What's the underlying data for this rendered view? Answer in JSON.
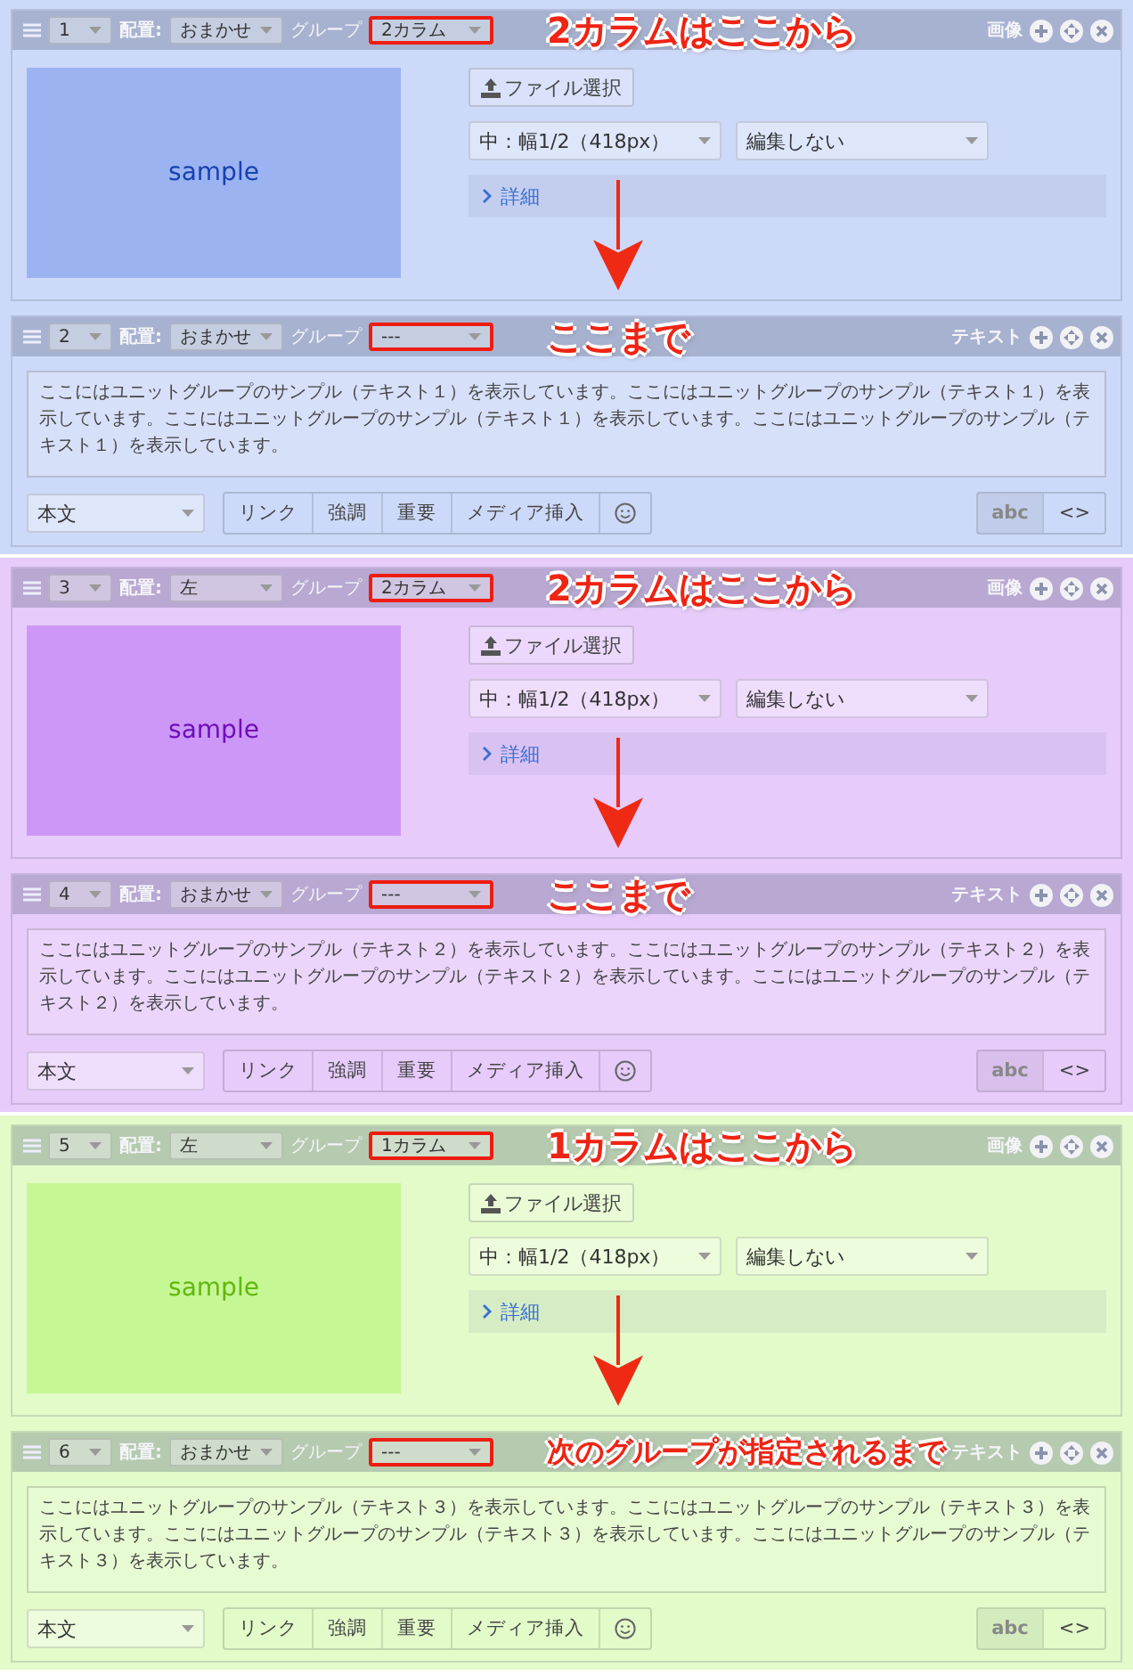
{
  "groups": [
    {
      "color": "#cdd9f8",
      "units": [
        {
          "kind": "image",
          "number": "1",
          "placement_label": "配置:",
          "placement": "おまかせ",
          "group_label": "グループ",
          "group_value": "2カラム",
          "group_highlighted": true,
          "type_label": "画像",
          "picture_label": "sample",
          "file_button": "ファイル選択",
          "size_select": "中：幅1/2（418px）",
          "edit_select": "編集しない",
          "details": "詳細",
          "callout": [
            "2カラムはここから"
          ],
          "arrow": true
        },
        {
          "kind": "text",
          "number": "2",
          "placement_label": "配置:",
          "placement": "おまかせ",
          "group_label": "グループ",
          "group_value": "---",
          "group_highlighted": true,
          "type_label": "テキスト",
          "text": "ここにはユニットグループのサンプル（テキスト１）を表示しています。ここにはユニットグループのサンプル（テキスト１）を表示しています。ここにはユニットグループのサンプル（テキスト１）を表示しています。ここにはユニットグループのサンプル（テキスト１）を表示しています。",
          "style_select": "本文",
          "buttons": [
            "リンク",
            "強調",
            "重要",
            "メディア挿入"
          ],
          "abc_button": "abc",
          "abc_disabled": true,
          "code_button": "<>",
          "callout": [
            "ここまで"
          ]
        }
      ]
    },
    {
      "color": "#e6cbfb",
      "units": [
        {
          "kind": "image",
          "number": "3",
          "placement_label": "配置:",
          "placement": "左",
          "group_label": "グループ",
          "group_value": "2カラム",
          "group_highlighted": true,
          "type_label": "画像",
          "picture_label": "sample",
          "file_button": "ファイル選択",
          "size_select": "中：幅1/2（418px）",
          "edit_select": "編集しない",
          "details": "詳細",
          "callout": [
            "2カラムはここから"
          ],
          "arrow": true
        },
        {
          "kind": "text",
          "number": "4",
          "placement_label": "配置:",
          "placement": "おまかせ",
          "group_label": "グループ",
          "group_value": "---",
          "group_highlighted": true,
          "type_label": "テキスト",
          "text": "ここにはユニットグループのサンプル（テキスト２）を表示しています。ここにはユニットグループのサンプル（テキスト２）を表示しています。ここにはユニットグループのサンプル（テキスト２）を表示しています。ここにはユニットグループのサンプル（テキスト２）を表示しています。",
          "style_select": "本文",
          "buttons": [
            "リンク",
            "強調",
            "重要",
            "メディア挿入"
          ],
          "abc_button": "abc",
          "abc_disabled": true,
          "code_button": "<>",
          "callout": [
            "ここまで"
          ]
        }
      ]
    },
    {
      "color": "#e2fbc9",
      "units": [
        {
          "kind": "image",
          "number": "5",
          "placement_label": "配置:",
          "placement": "左",
          "group_label": "グループ",
          "group_value": "1カラム",
          "group_highlighted": true,
          "type_label": "画像",
          "picture_label": "sample",
          "file_button": "ファイル選択",
          "size_select": "中：幅1/2（418px）",
          "edit_select": "編集しない",
          "details": "詳細",
          "callout": [
            "1カラムはここから"
          ],
          "arrow": true
        },
        {
          "kind": "text",
          "number": "6",
          "placement_label": "配置:",
          "placement": "おまかせ",
          "group_label": "グループ",
          "group_value": "---",
          "group_highlighted": true,
          "type_label": "テキスト",
          "text": "ここにはユニットグループのサンプル（テキスト３）を表示しています。ここにはユニットグループのサンプル（テキスト３）を表示しています。ここにはユニットグループのサンプル（テキスト３）を表示しています。ここにはユニットグループのサンプル（テキスト３）を表示しています。",
          "style_select": "本文",
          "buttons": [
            "リンク",
            "強調",
            "重要",
            "メディア挿入"
          ],
          "abc_button": "abc",
          "abc_disabled": true,
          "code_button": "<>",
          "callout": [
            "次のグループが指定",
            "されるまで"
          ]
        }
      ]
    }
  ]
}
